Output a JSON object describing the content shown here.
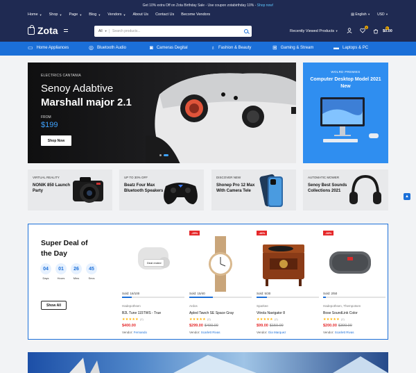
{
  "promo": {
    "text": "Get 10% extra Off on Zota Birthday Sale - Use coupon zotabirthday 10% -",
    "link": "Shop now!"
  },
  "topnav": [
    {
      "label": "Home",
      "caret": true
    },
    {
      "label": "Shop",
      "caret": true
    },
    {
      "label": "Page",
      "caret": true
    },
    {
      "label": "Blog",
      "caret": true
    },
    {
      "label": "Vendors",
      "caret": true
    },
    {
      "label": "About Us",
      "caret": false
    },
    {
      "label": "Contact Us",
      "caret": false
    },
    {
      "label": "Become Vendors",
      "caret": false
    }
  ],
  "lang": {
    "language": "English",
    "currency": "USD"
  },
  "logo": {
    "name": "Zota"
  },
  "search": {
    "category": "All",
    "placeholder": "Search products..."
  },
  "header": {
    "recently_viewed": "Recently Viewed Products",
    "cart_amount": "$0.00",
    "wishlist_count": "0",
    "cart_count": "0"
  },
  "categories": [
    {
      "label": "Home Appliances",
      "icon": "appliance-icon"
    },
    {
      "label": "Bluetooth Audio",
      "icon": "headphones-icon"
    },
    {
      "label": "Cameras Degital",
      "icon": "camera-icon"
    },
    {
      "label": "Fashion & Beauty",
      "icon": "tshirt-icon"
    },
    {
      "label": "Gaming & Stream",
      "icon": "gamepad-icon"
    },
    {
      "label": "Laptops & PC",
      "icon": "laptop-icon"
    }
  ],
  "hero": {
    "supertitle": "ELECTRICS CANTANIA",
    "title1": "Senoy Adabtive",
    "title2": "Marshall major 2.1",
    "from": "FROM",
    "price": "$199",
    "button": "Shop Now"
  },
  "side_banner": {
    "supertitle": "WOLRD PREMIES",
    "title": "Computer Desktop Model 2021 New"
  },
  "minis": [
    {
      "sup": "VIRTUAL REALITY",
      "title": "NONIK 850 Launch Party"
    },
    {
      "sup": "UP TO 30% OFF",
      "title": "Beatz Four Max Bluetooth Speakers"
    },
    {
      "sup": "DISCOVER NEW",
      "title": "Shonep Pro 12 Max With Camera Tele"
    },
    {
      "sup": "AUTOMATIC MOWER",
      "title": "Senoy Best Sounds Collections 2021"
    }
  ],
  "deal": {
    "title": "Super Deal of the Day",
    "timer": [
      {
        "value": "04",
        "unit": "Days"
      },
      {
        "value": "01",
        "unit": "Hours"
      },
      {
        "value": "26",
        "unit": "Mins"
      },
      {
        "value": "45",
        "unit": "Secs"
      }
    ],
    "show_all": "Show All",
    "deal_ended": "Deal ended",
    "products": [
      {
        "discount": "",
        "sold": "Sold: 16/100",
        "sold_frac": 0.16,
        "vendor_cat": "Hadepothsen",
        "name": "B2L Tune 115TWS - True",
        "rating": 5,
        "reviews": "(2)",
        "price": "$400.00",
        "old_price": "",
        "vendor_label": "Vendor:",
        "vendor": "Fernando"
      },
      {
        "discount": "-25%",
        "sold": "Sold: 15/40",
        "sold_frac": 0.375,
        "vendor_cat": "Ardos",
        "name": "Apled Tawch SE Space Gray",
        "rating": 5,
        "reviews": "(2)",
        "price": "$299.00",
        "old_price": "$400.00",
        "vendor_label": "Vendor:",
        "vendor": "Scarlett Rivas"
      },
      {
        "discount": "-46%",
        "sold": "Sold: 5/30",
        "sold_frac": 0.167,
        "vendor_cat": "Sparkee",
        "name": "Vitrola Navigator 8",
        "rating": 5,
        "reviews": "(2)",
        "price": "$99.00",
        "old_price": "$150.00",
        "vendor_label": "Vendor:",
        "vendor": "Gia Marquez"
      },
      {
        "discount": "-33%",
        "sold": "Sold: 2/50",
        "sold_frac": 0.04,
        "vendor_cat": "Hadepothsen, Thempotsen",
        "name": "Bose SoundLink Color",
        "rating": 5,
        "reviews": "(2)",
        "price": "$200.00",
        "old_price": "$300.00",
        "vendor_label": "Vendor:",
        "vendor": "Scarlett Rivas"
      }
    ]
  }
}
